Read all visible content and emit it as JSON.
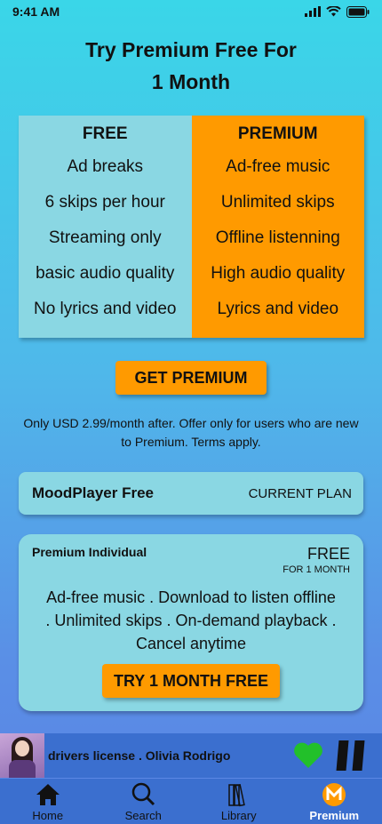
{
  "status": {
    "time": "9:41 AM"
  },
  "header": {
    "title_line1": "Try Premium Free For",
    "title_line2": "1 Month"
  },
  "compare": {
    "free": {
      "heading": "FREE",
      "features": [
        "Ad breaks",
        "6 skips per hour",
        "Streaming only",
        "basic audio quality",
        "No lyrics and video"
      ]
    },
    "premium": {
      "heading": "PREMIUM",
      "features": [
        "Ad-free music",
        "Unlimited skips",
        "Offline listenning",
        "High audio quality",
        "Lyrics and video"
      ]
    }
  },
  "cta": {
    "get_premium": "GET PREMIUM"
  },
  "note": "Only USD 2.99/month after. Offer only for users who are new to Premium. Terms apply.",
  "current_plan": {
    "name": "MoodPlayer Free",
    "tag": "CURRENT PLAN"
  },
  "premium_card": {
    "title": "Premium Individual",
    "price": "FREE",
    "price_sub": "FOR 1 MONTH",
    "description_lines": [
      "Ad-free music . Download to listen offline",
      ". Unlimited skips . On-demand playback .",
      "Cancel anytime"
    ],
    "button": "TRY 1 MONTH FREE"
  },
  "player": {
    "track": "drivers license . Olivia Rodrigo",
    "liked": true,
    "heart_color": "#22c02a"
  },
  "tabs": [
    {
      "label": "Home",
      "icon": "home-icon",
      "active": false
    },
    {
      "label": "Search",
      "icon": "search-icon",
      "active": false
    },
    {
      "label": "Library",
      "icon": "library-icon",
      "active": false
    },
    {
      "label": "Premium",
      "icon": "premium-logo-icon",
      "active": true
    }
  ],
  "colors": {
    "accent": "#ff9a00",
    "card": "#8ad7e3",
    "bar": "#3b6fcf"
  }
}
